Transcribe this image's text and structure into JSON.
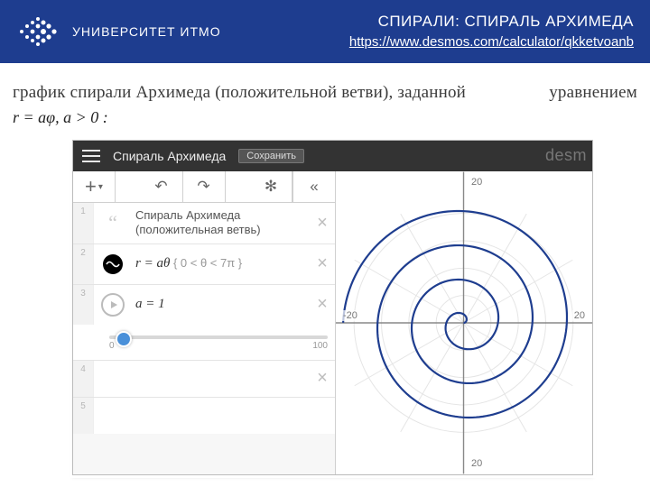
{
  "header": {
    "university": "УНИВЕРСИТЕТ ИТМО",
    "slide_title": "СПИРАЛИ: СПИРАЛЬ АРХИМЕДА",
    "slide_link": "https://www.desmos.com/calculator/qkketvoanb"
  },
  "caption": {
    "lead": "график спирали Архимеда (положительной ветви), заданной",
    "trail": "уравнением",
    "equation": "r = aφ, a > 0 :"
  },
  "desmos": {
    "title": "Спираль Архимеда",
    "save_label": "Сохранить",
    "brand": "desm",
    "toolbar": {
      "add": "+",
      "undo_glyph": "↶",
      "redo_glyph": "↷",
      "settings_glyph": "✻",
      "collapse_glyph": "«"
    },
    "rows": [
      {
        "num": "1",
        "kind": "note",
        "title_line1": "Спираль Архимеда",
        "title_line2": "(положительная ветвь)"
      },
      {
        "num": "2",
        "kind": "expr",
        "expr": "r = aθ",
        "cond": "{ 0 < θ < 7π }"
      },
      {
        "num": "3",
        "kind": "slider",
        "expr": "a = 1",
        "min": "0",
        "max": "100"
      },
      {
        "num": "4",
        "kind": "empty"
      },
      {
        "num": "5",
        "kind": "empty"
      }
    ],
    "axes": {
      "ticks": [
        "-20",
        "20",
        "-20",
        "20"
      ],
      "max_r": 23
    }
  },
  "chart_data": {
    "type": "line",
    "coords": "polar",
    "title": "Спираль Архимеда (положительная ветвь)",
    "equation": "r = a·θ",
    "params": {
      "a": 1
    },
    "theta_range": [
      0,
      21.99
    ],
    "series": [
      {
        "name": "r = θ",
        "theta_samples": "0..7π",
        "r_of_theta": "θ"
      }
    ],
    "x_ticks": [
      -20,
      20
    ],
    "y_ticks": [
      -20,
      20
    ],
    "xlim": [
      -23,
      23
    ],
    "ylim": [
      -23,
      23
    ]
  }
}
